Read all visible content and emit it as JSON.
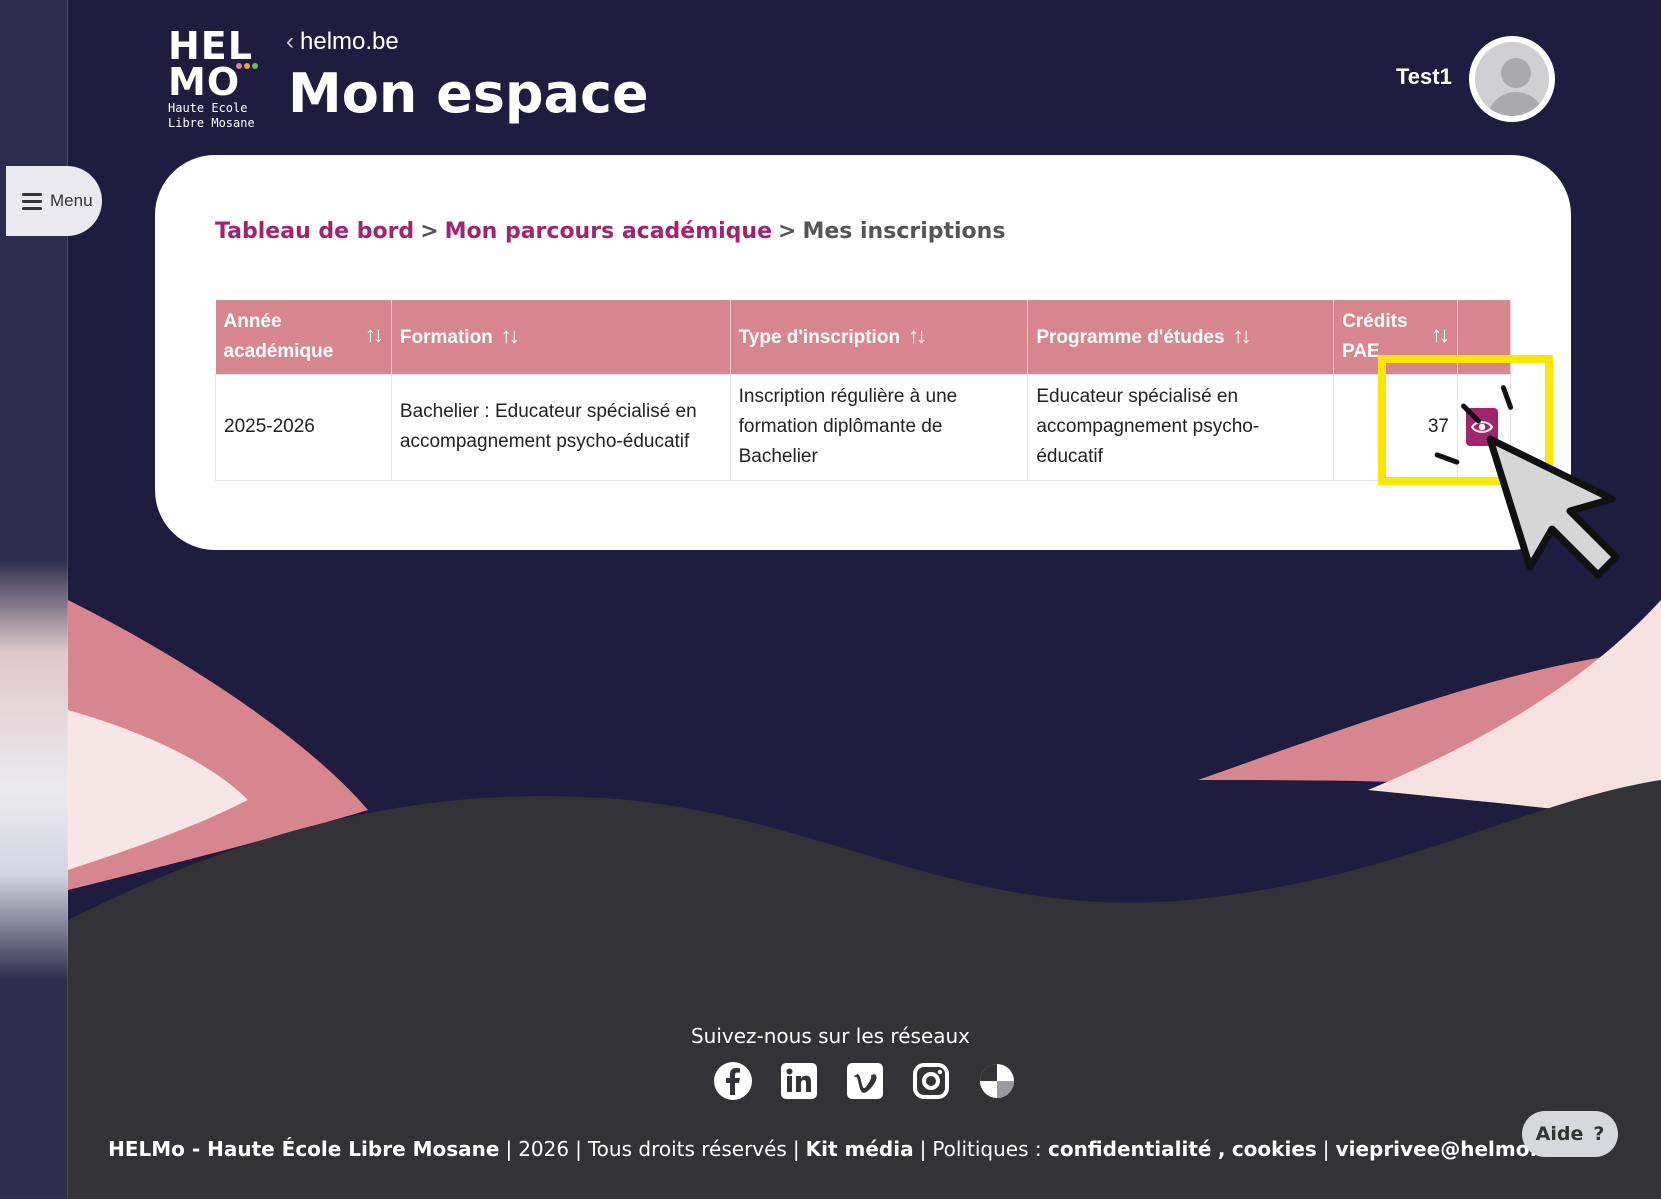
{
  "menu": {
    "label": "Menu"
  },
  "logo": {
    "line1": "HEL",
    "line2": "MO",
    "sub1": "Haute Ecole",
    "sub2": "Libre Mosane"
  },
  "header": {
    "back_link": "helmo.be",
    "title": "Mon espace",
    "user": "Test1"
  },
  "breadcrumb": {
    "items": [
      {
        "label": "Tableau de bord"
      },
      {
        "label": "Mon parcours académique"
      }
    ],
    "separator": ">",
    "current": "Mes inscriptions"
  },
  "table": {
    "headers": {
      "annee_l1": "Année",
      "annee_l2": "académique",
      "formation": "Formation",
      "type": "Type d'inscription",
      "programme": "Programme d'études",
      "credits_l1": "Crédits",
      "credits_l2": "PAE",
      "sort_glyph": "↑↓"
    },
    "rows": [
      {
        "annee": "2025-2026",
        "formation": "Bachelier : Educateur spécialisé en accompagnement psycho-éducatif",
        "type": "Inscription régulière à une formation diplômante de Bachelier",
        "programme": "Educateur spécialisé en accompagnement psycho-éducatif",
        "credits": "37"
      }
    ]
  },
  "footer": {
    "follow": "Suivez-nous sur les réseaux",
    "org": "HELMo - Haute École Libre Mosane",
    "year": "2026",
    "rights": "Tous droits réservés",
    "kit": "Kit média",
    "policies_prefix": "Politiques :",
    "privacy": "confidentialité",
    "comma": ",",
    "cookies": "cookies",
    "email": "vieprivee@helmo.be",
    "pipe": "|"
  },
  "help": {
    "label": "Aide",
    "glyph": "?"
  },
  "colors": {
    "background": "#1e1c3f",
    "accent": "#a3246e",
    "header_row": "#d8868e",
    "highlight": "#ffe600",
    "footer_dark": "#333237"
  },
  "icons": [
    "menu-icon",
    "chevron-left-icon",
    "avatar-icon",
    "sort-icon",
    "eye-icon",
    "facebook-icon",
    "linkedin-icon",
    "vimeo-icon",
    "instagram-icon",
    "flickr-icon",
    "cursor-pointer-icon"
  ]
}
